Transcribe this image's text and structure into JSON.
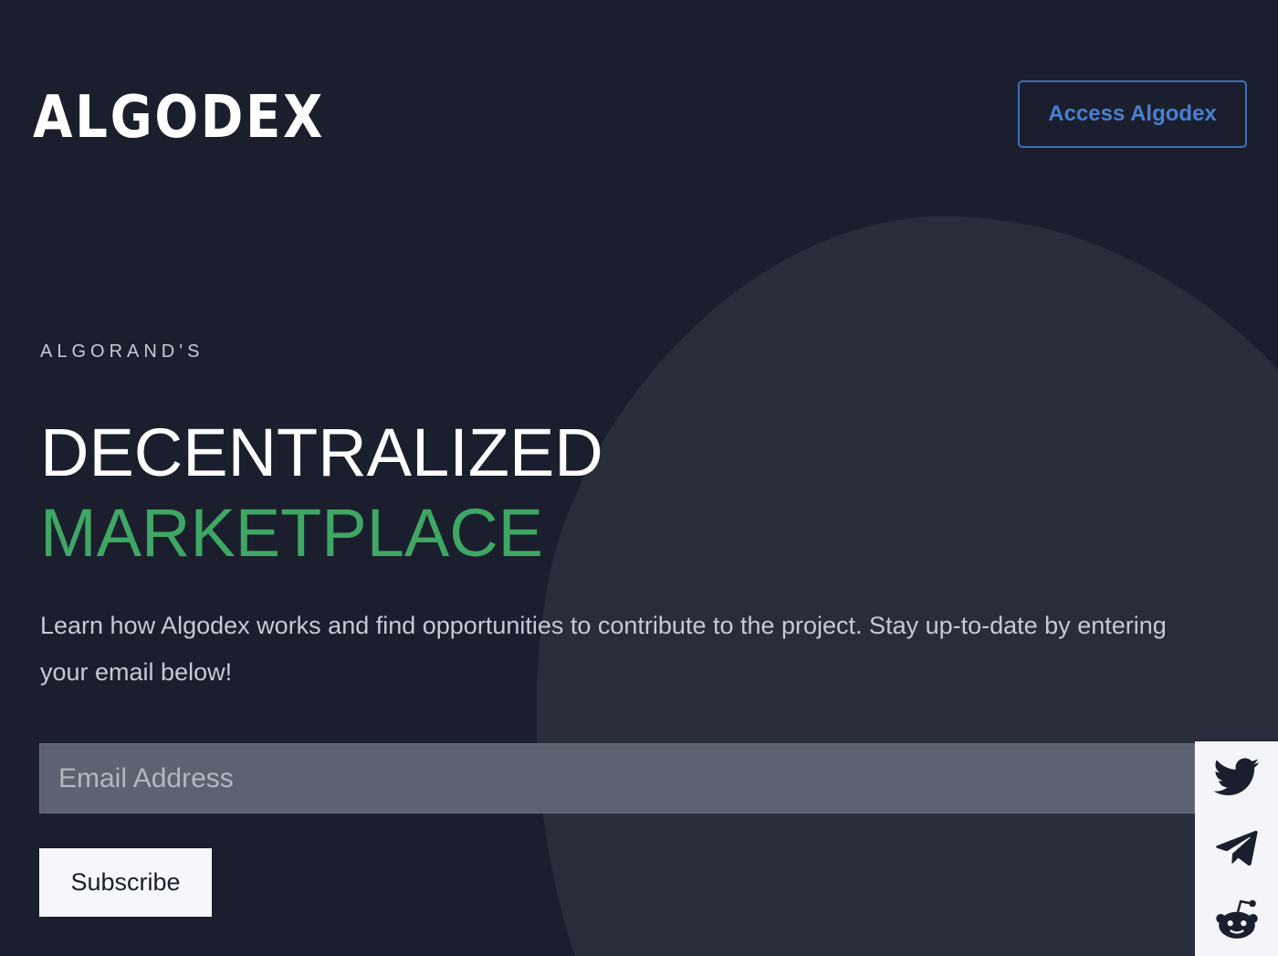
{
  "header": {
    "logo_text": "ALGODEX",
    "access_button": "Access Algodex"
  },
  "hero": {
    "eyebrow": "ALGORAND'S",
    "headline_line1": "DECENTRALIZED",
    "headline_line2": "MARKETPLACE",
    "description": "Learn how Algodex works and find opportunities to contribute to the project. Stay up-to-date by entering your email below!"
  },
  "form": {
    "email_placeholder": "Email Address",
    "email_value": "",
    "subscribe_label": "Subscribe"
  },
  "social": {
    "items": [
      {
        "icon": "twitter-icon"
      },
      {
        "icon": "telegram-icon"
      },
      {
        "icon": "reddit-icon"
      }
    ]
  },
  "colors": {
    "background": "#1b1f2d",
    "accent_green": "#3fa764",
    "accent_blue": "#4a7fd0",
    "input_bg": "#5d6270"
  }
}
